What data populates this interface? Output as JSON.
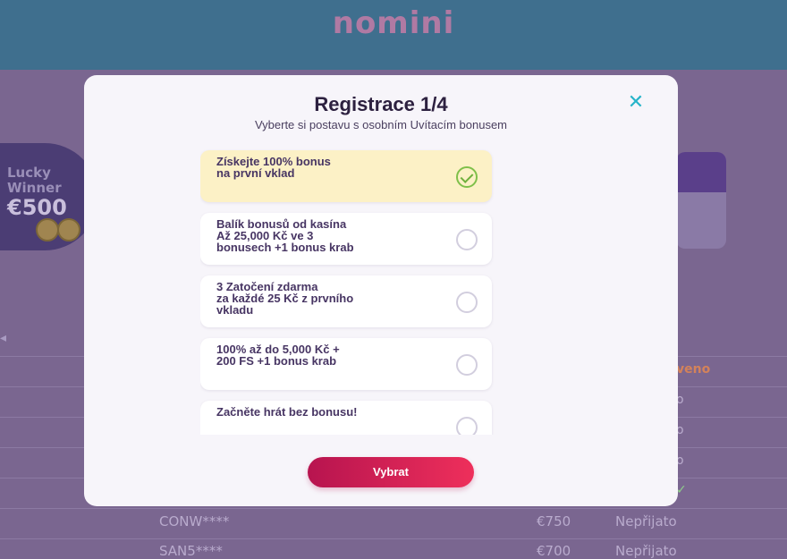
{
  "background": {
    "logo": "nomini",
    "promo_text": "Lucky Winner",
    "promo_amount": "€500",
    "status_top": "veno",
    "rows": [
      {
        "user": "CONW****",
        "amount": "€750",
        "status": "Nepřijato"
      },
      {
        "user": "SAN5****",
        "amount": "€700",
        "status": "Nepřijato"
      }
    ],
    "partial_status": [
      "o",
      "o",
      "o"
    ]
  },
  "modal": {
    "title": "Registrace 1/4",
    "subtitle": "Vyberte si postavu s osobním Uvítacím bonusem",
    "close_label": "✕",
    "choose_label": "Vybrat",
    "options": [
      {
        "character": "broccoli-character",
        "text_line1": "Získejte 100% bonus",
        "text_line2": "na první vklad",
        "text_line3": "",
        "selected": true
      },
      {
        "character": "banana-character",
        "text_line1": "Balík bonusů od kasína",
        "text_line2": "Až 25,000 Kč ve 3",
        "text_line3": "bonusech +1 bonus krab",
        "selected": false
      },
      {
        "character": "watermelon-character",
        "text_line1": "3 Zatočení zdarma",
        "text_line2": "za každé 25 Kč z prvního",
        "text_line3": "vkladu",
        "selected": false
      },
      {
        "character": "cherry-character",
        "text_line1": "100% až do 5,000 Kč +",
        "text_line2": "200 FS +1 bonus krab",
        "text_line3": "",
        "selected": false
      },
      {
        "character": "pineapple-character",
        "text_line1": "Začněte hrát bez bonusu!",
        "text_line2": "",
        "text_line3": "",
        "selected": false
      }
    ]
  },
  "colors": {
    "accent": "#27b4c9",
    "button_start": "#b7144f",
    "button_end": "#ee2f5b",
    "selected_bg": "#fcf1c6",
    "check": "#6fb03c"
  }
}
